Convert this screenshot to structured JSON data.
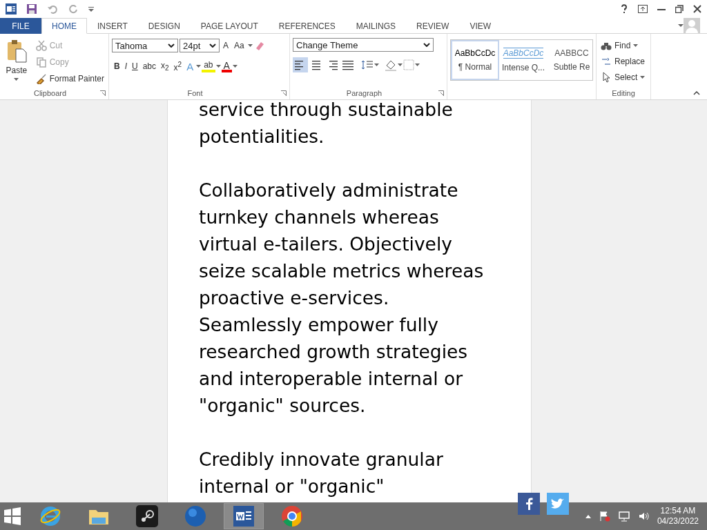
{
  "tabs": [
    {
      "label": "FILE",
      "kind": "file",
      "selected": false
    },
    {
      "label": "HOME",
      "kind": "tab",
      "selected": true
    },
    {
      "label": "INSERT",
      "kind": "tab",
      "selected": false
    },
    {
      "label": "DESIGN",
      "kind": "tab",
      "selected": false
    },
    {
      "label": "PAGE LAYOUT",
      "kind": "tab",
      "selected": false
    },
    {
      "label": "REFERENCES",
      "kind": "tab",
      "selected": false
    },
    {
      "label": "MAILINGS",
      "kind": "tab",
      "selected": false
    },
    {
      "label": "REVIEW",
      "kind": "tab",
      "selected": false
    },
    {
      "label": "VIEW",
      "kind": "tab",
      "selected": false
    }
  ],
  "clipboard": {
    "label": "Clipboard",
    "paste": "Paste",
    "items": [
      {
        "label": "Cut",
        "disabled": true
      },
      {
        "label": "Copy",
        "disabled": true
      },
      {
        "label": "Format Painter",
        "disabled": false
      }
    ]
  },
  "font": {
    "label": "Font",
    "name": "Tahoma",
    "size": "24pt",
    "grow": "A",
    "case": "Aa",
    "format_buttons": [
      "B",
      "I",
      "U",
      "abc",
      "x$_{2}$",
      "x$^{2}$"
    ],
    "effects": "A",
    "highlight": "ab",
    "font_color_label": "A"
  },
  "paragraph": {
    "label": "Paragraph",
    "theme": "Change Theme",
    "alignments": [
      {
        "selected": true
      },
      {
        "selected": false
      },
      {
        "selected": false
      },
      {
        "selected": false
      }
    ]
  },
  "styles": [
    {
      "preview": "AaBbCcDc",
      "name": "¶ Normal",
      "kind": "normal",
      "selected": true
    },
    {
      "preview": "AaBbCcDc",
      "name": "Intense Q...",
      "kind": "intense",
      "selected": false
    },
    {
      "preview": "AABBCC",
      "name": "Subtle Re",
      "kind": "subtle",
      "selected": false
    }
  ],
  "editing": {
    "label": "Editing",
    "items": [
      "Find",
      "Replace",
      "Select"
    ]
  },
  "document": {
    "paragraphs": [
      [
        "service through sustainable",
        "potentialities."
      ],
      [
        "Collaboratively administrate",
        "turnkey channels whereas",
        "virtual e-tailers. Objectively",
        "seize scalable metrics whereas",
        "proactive e-services.",
        "Seamlessly empower fully",
        "researched growth strategies",
        "and interoperable internal or",
        "\"organic\" sources."
      ],
      [
        "Credibly innovate granular",
        "internal or \"organic\""
      ]
    ]
  },
  "taskbar": {
    "apps": [
      {
        "kind": "ie",
        "selected": false
      },
      {
        "kind": "explorer",
        "selected": false
      },
      {
        "kind": "steam",
        "selected": false
      },
      {
        "kind": "globe",
        "selected": false
      },
      {
        "kind": "word",
        "selected": true
      },
      {
        "kind": "chrome",
        "selected": false
      }
    ],
    "time": "12:54 AM",
    "date": "04/23/2022"
  }
}
